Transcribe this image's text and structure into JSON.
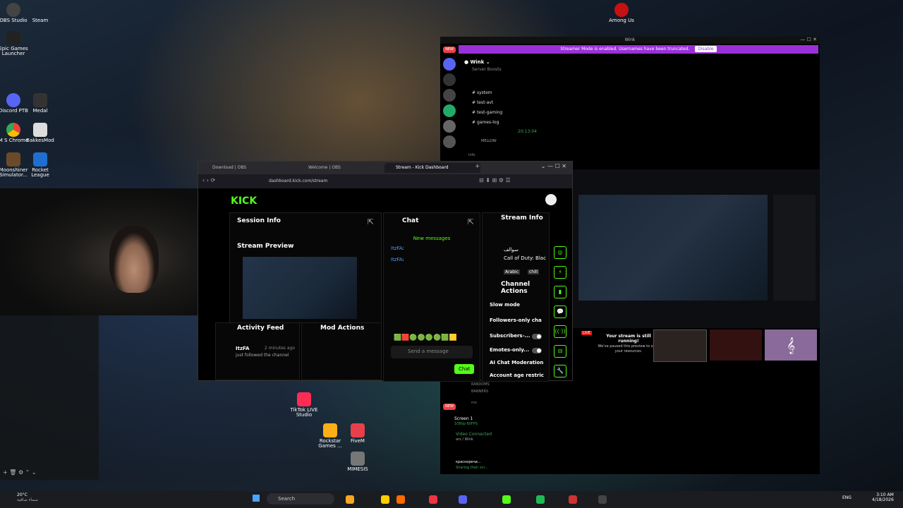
{
  "desktop": {
    "icons": [
      {
        "label": "OBS Studio",
        "x": 0
      },
      {
        "label": "Steam",
        "x": 0
      },
      {
        "label": "Epic Games Launcher",
        "x": 0
      },
      {
        "label": "Discord PTB",
        "x": 0
      },
      {
        "label": "Medal",
        "x": 0
      },
      {
        "label": "M S Chrome",
        "x": 0
      },
      {
        "label": "BakkesMod",
        "x": 0
      },
      {
        "label": "Moonshiner Simulator...",
        "x": 0
      },
      {
        "label": "Rocket League",
        "x": 0
      },
      {
        "label": "Among Us",
        "x": 0
      },
      {
        "label": "TikTok LIVE Studio",
        "x": 0
      },
      {
        "label": "Rockstar Games ...",
        "x": 0
      },
      {
        "label": "FiveM",
        "x": 0
      },
      {
        "label": "MIMESIS",
        "x": 0
      }
    ]
  },
  "discord": {
    "title": "Wink",
    "banner_text": "Streamer Mode is enabled. Usernames have been truncated.",
    "banner_button": "Disable",
    "server_name": "Wink",
    "new_badge": "NEW",
    "boost_text": "Server Boosts",
    "channels": [
      "system",
      "test-avt",
      "test-gaming",
      "games-log"
    ],
    "voice_time": "20:13:04",
    "voice_user": "MELLOW",
    "info_label": "Info",
    "lower_channels": [
      "RANDOMS",
      "BANNERS",
      "rnv"
    ],
    "screen_share": {
      "title": "Screen 1",
      "sub": "1080p 60FPS"
    },
    "video_status": "Video Connected",
    "video_sub": "ars / Wink",
    "user_name": "красноречи...",
    "user_status": "Sharing their scr..."
  },
  "browser": {
    "tabs": [
      {
        "label": "Download | OBS"
      },
      {
        "label": "Welcome | OBS"
      },
      {
        "label": "Stream - Kick Dashboard"
      }
    ],
    "url": "dashboard.kick.com/stream"
  },
  "kick": {
    "logo": "KICK",
    "session_info": "Session Info",
    "stream_preview": "Stream Preview",
    "chat_title": "Chat",
    "new_messages": "New messages",
    "chat_messages": [
      {
        "user": "ItzFA",
        "text": ":"
      },
      {
        "user": "ItzFA",
        "text": ":"
      }
    ],
    "send_placeholder": "Send a message",
    "chat_button": "Chat",
    "stream_info": "Stream Info",
    "stream_title": "سوالف",
    "category": "Call of Duty: Blac",
    "tags": [
      "Arabic",
      "chill"
    ],
    "channel_actions": "Channel Actions",
    "actions": [
      {
        "label": "Slow mode"
      },
      {
        "label": "Followers-only cha"
      },
      {
        "label": "Subscribers-..."
      },
      {
        "label": "Emotes-only..."
      },
      {
        "label": "AI Chat Moderation"
      },
      {
        "label": "Account age restric"
      }
    ],
    "activity_feed": "Activity Feed",
    "mod_actions": "Mod Actions",
    "activity": {
      "user": "ItzFA",
      "time": "2 minutes ago",
      "text": "just followed the channel"
    }
  },
  "obs_preview": {
    "live_badge": "LIVE",
    "running_text": "Your stream is still running!",
    "paused_text": "We've paused this preview to save your resources."
  },
  "taskbar": {
    "weather": "20°C",
    "weather_sub": "سماء صافية",
    "search": "Search",
    "lang": "ENG",
    "time": "3:10 AM",
    "date": "4/18/2026"
  },
  "colors": {
    "kick_green": "#53fc18",
    "discord_purple": "#9b30d9"
  }
}
